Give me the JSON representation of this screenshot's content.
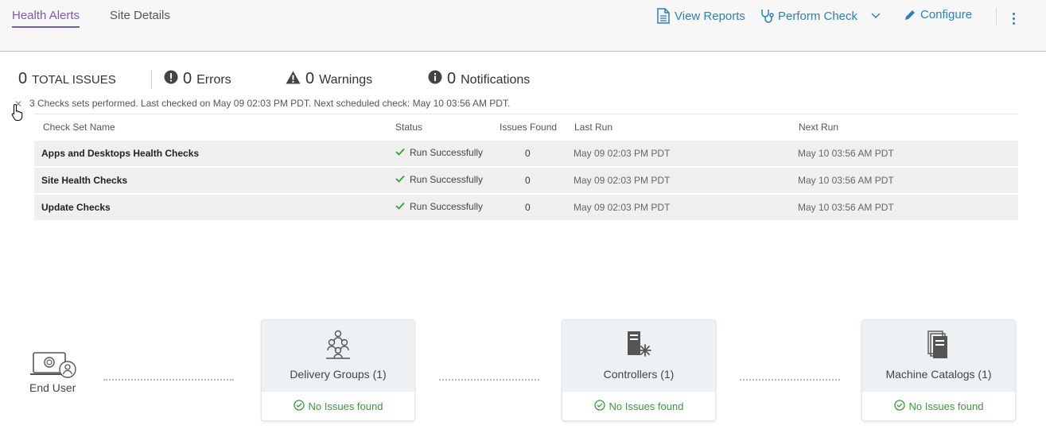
{
  "tabs": [
    {
      "label": "Health Alerts",
      "active": true
    },
    {
      "label": "Site Details",
      "active": false
    }
  ],
  "toolbar": {
    "view_reports": "View Reports",
    "perform_check": "Perform Check",
    "configure": "Configure"
  },
  "summary": {
    "total": {
      "count": "0",
      "label": "TOTAL ISSUES"
    },
    "errors": {
      "count": "0",
      "label": "Errors"
    },
    "warnings": {
      "count": "0",
      "label": "Warnings"
    },
    "notifications": {
      "count": "0",
      "label": "Notifications"
    }
  },
  "check_info": "3 Checks sets performed. Last checked on May 09 02:03 PM PDT. Next scheduled check: May 10 03:56 AM PDT.",
  "table": {
    "headers": [
      "Check Set Name",
      "Status",
      "Issues Found",
      "Last Run",
      "Next Run"
    ],
    "rows": [
      {
        "name": "Apps and Desktops Health Checks",
        "status": "Run Successfully",
        "issues": "0",
        "last_run": "May 09 02:03 PM PDT",
        "next_run": "May 10 03:56 AM PDT"
      },
      {
        "name": "Site Health Checks",
        "status": "Run Successfully",
        "issues": "0",
        "last_run": "May 09 02:03 PM PDT",
        "next_run": "May 10 03:56 AM PDT"
      },
      {
        "name": "Update Checks",
        "status": "Run Successfully",
        "issues": "0",
        "last_run": "May 09 02:03 PM PDT",
        "next_run": "May 10 03:56 AM PDT"
      }
    ]
  },
  "diagram": {
    "end_user": "End User",
    "cards": [
      {
        "title": "Delivery Groups (1)",
        "status": "No Issues found",
        "icon": "delivery-groups-icon"
      },
      {
        "title": "Controllers (1)",
        "status": "No Issues found",
        "icon": "controllers-icon"
      },
      {
        "title": "Machine Catalogs (1)",
        "status": "No Issues found",
        "icon": "machine-catalogs-icon"
      }
    ]
  },
  "colors": {
    "accent": "#7a5ab8",
    "link": "#2d7fc0",
    "success": "#3a9a3a"
  }
}
